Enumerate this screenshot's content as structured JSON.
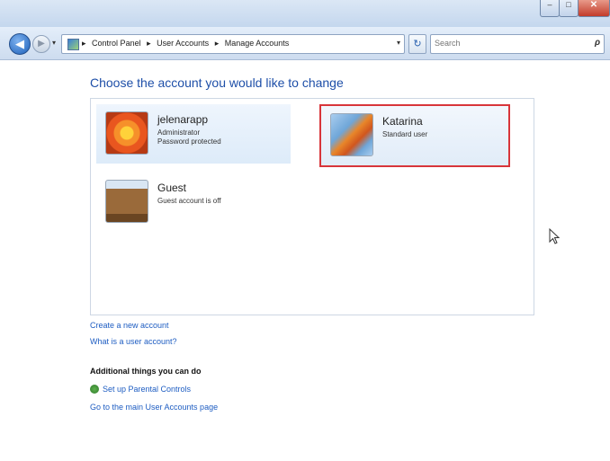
{
  "window": {
    "controls": {
      "minimize": "–",
      "maximize": "□",
      "close": "✕"
    }
  },
  "nav": {
    "back_glyph": "◀",
    "forward_glyph": "▶",
    "recent_glyph": "▾",
    "breadcrumb": [
      "Control Panel",
      "User Accounts",
      "Manage Accounts"
    ],
    "separator": "▸",
    "dropdown_glyph": "▾",
    "refresh_glyph": "↻",
    "search_placeholder": "Search",
    "search_glyph": "ρ"
  },
  "main": {
    "heading": "Choose the account you would like to change",
    "accounts": [
      {
        "name": "jelenarapp",
        "lines": [
          "Administrator",
          "Password protected"
        ],
        "picture": "flower"
      },
      {
        "name": "Katarina",
        "lines": [
          "Standard user"
        ],
        "picture": "leaf"
      },
      {
        "name": "Guest",
        "lines": [
          "Guest account is off"
        ],
        "picture": "briefcase"
      }
    ],
    "links": {
      "create": "Create a new account",
      "what_is": "What is a user account?"
    },
    "additional": {
      "title": "Additional things you can do",
      "parental": "Set up Parental Controls",
      "main_page": "Go to the main User Accounts page"
    }
  },
  "colors": {
    "link": "#1e5dc2",
    "heading": "#1e4fa8",
    "selection_outline": "#d8353a"
  }
}
